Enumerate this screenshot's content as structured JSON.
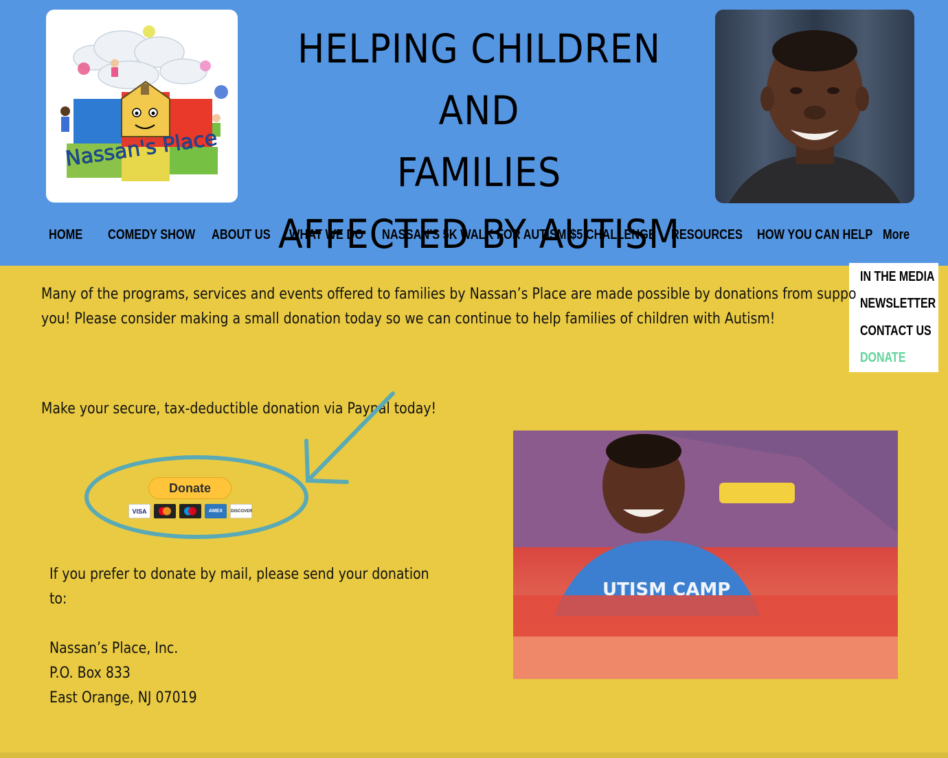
{
  "header": {
    "logo_alt": "Nassan's Place",
    "title_lines": [
      "HELPING CHILDREN AND",
      "FAMILIES",
      "AFFECTED BY AUTISM"
    ],
    "bg_color": "#5596E2"
  },
  "nav": {
    "items": [
      {
        "label": "HOME"
      },
      {
        "label": "COMEDY SHOW"
      },
      {
        "label": "ABOUT US"
      },
      {
        "label": "WHAT WE DO"
      },
      {
        "label": "NASSAN'S 5K WALK FOR AUTISM"
      },
      {
        "label": "$5 CHALLENGE"
      },
      {
        "label": "RESOURCES"
      },
      {
        "label": "HOW YOU CAN HELP"
      },
      {
        "label": "More"
      }
    ],
    "dropdown": [
      {
        "label": "IN THE MEDIA"
      },
      {
        "label": "NEWSLETTER"
      },
      {
        "label": "CONTACT US"
      },
      {
        "label": "DONATE",
        "active": true
      }
    ],
    "active_color": "#5FD49A"
  },
  "content": {
    "intro_line1": "Many of the programs, services and events offered to families by Nassan’s Place are made possible by donations from suppo",
    "intro_line2": "you!  Please consider making a small donation today so we can continue to help families of children with Autism!",
    "paypal_line": "Make your secure, tax-deductible donation via Paypal today!",
    "donate_button": "Donate",
    "cards": [
      "VISA",
      "Mastercard",
      "Maestro",
      "AMEX",
      "DISCOVER"
    ],
    "mail_line1": "If you prefer to donate by mail, please send your donation",
    "mail_line2": "to:",
    "address_line1": "Nassan’s Place, Inc.",
    "address_line2": "P.O. Box 833",
    "address_line3": "East Orange, NJ 07019",
    "shirt_text": "UTISM CAMP"
  },
  "colors": {
    "page_bg": "#E9CA42",
    "annotation": "#5AA9B6",
    "paypal_yellow": "#FFC439"
  }
}
